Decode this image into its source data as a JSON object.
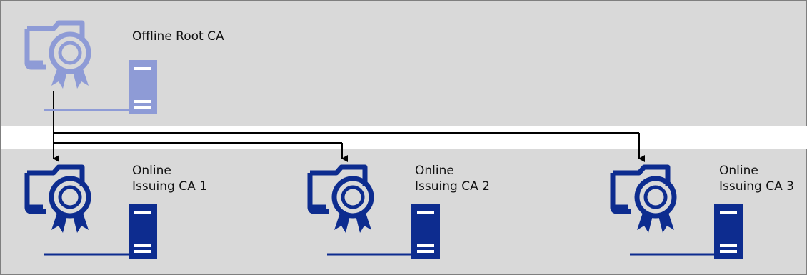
{
  "colors": {
    "background_band": "#d9d9d9",
    "offline_icon": "#8e9bd6",
    "online_icon": "#0d2c8f",
    "connector": "#000000"
  },
  "nodes": {
    "root": {
      "label": "Offline Root CA",
      "status": "offline",
      "icon": "certificate-server-icon"
    },
    "issuing_1": {
      "line1": "Online",
      "line2": "Issuing CA 1",
      "status": "online",
      "icon": "certificate-server-icon"
    },
    "issuing_2": {
      "line1": "Online",
      "line2": "Issuing CA 2",
      "status": "online",
      "icon": "certificate-server-icon"
    },
    "issuing_3": {
      "line1": "Online",
      "line2": "Issuing CA 3",
      "status": "online",
      "icon": "certificate-server-icon"
    }
  },
  "edges": [
    {
      "from": "root",
      "to": "issuing_1"
    },
    {
      "from": "root",
      "to": "issuing_2"
    },
    {
      "from": "root",
      "to": "issuing_3"
    }
  ]
}
